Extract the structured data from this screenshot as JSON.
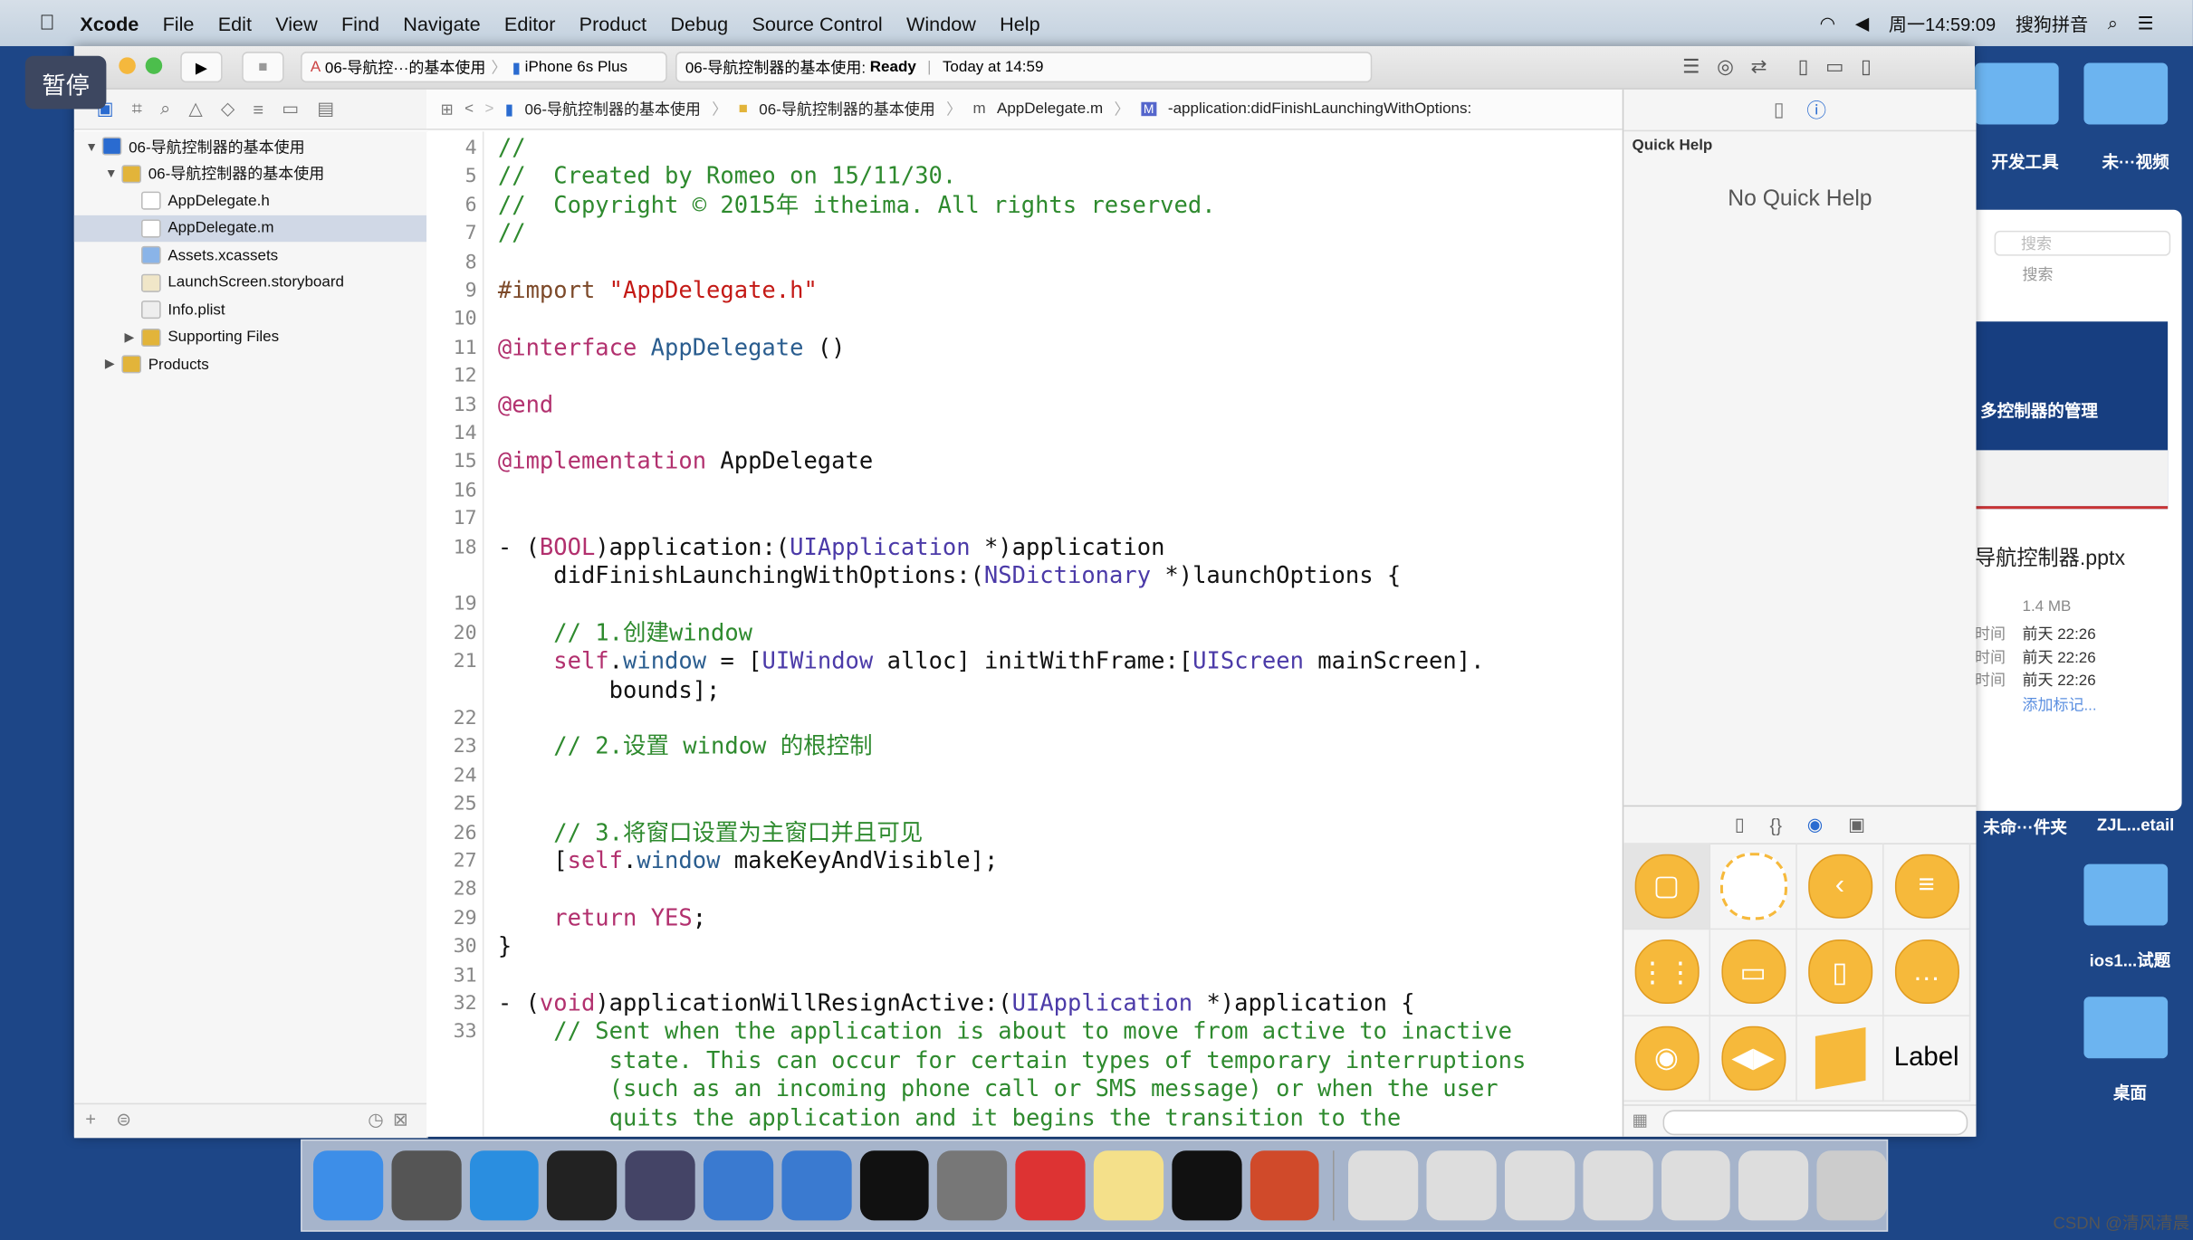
{
  "menubar": {
    "app": "Xcode",
    "items": [
      "File",
      "Edit",
      "View",
      "Find",
      "Navigate",
      "Editor",
      "Product",
      "Debug",
      "Source Control",
      "Window",
      "Help"
    ],
    "clock": "周一14:59:09",
    "input_method": "搜狗拼音"
  },
  "overlay": {
    "pause": "暂停"
  },
  "toolbar": {
    "scheme": "06-导航控···的基本使用",
    "device": "iPhone 6s Plus",
    "status_project": "06-导航控制器的基本使用:",
    "status": "Ready",
    "status_time": "Today at 14:59"
  },
  "navigator": {
    "items": [
      {
        "label": "06-导航控制器的基本使用",
        "indent": 0,
        "icon": "project",
        "open": true
      },
      {
        "label": "06-导航控制器的基本使用",
        "indent": 1,
        "icon": "folder",
        "open": true
      },
      {
        "label": "AppDelegate.h",
        "indent": 2,
        "icon": "h-file"
      },
      {
        "label": "AppDelegate.m",
        "indent": 2,
        "icon": "m-file",
        "selected": true
      },
      {
        "label": "Assets.xcassets",
        "indent": 2,
        "icon": "assets"
      },
      {
        "label": "LaunchScreen.storyboard",
        "indent": 2,
        "icon": "storyboard"
      },
      {
        "label": "Info.plist",
        "indent": 2,
        "icon": "plist"
      },
      {
        "label": "Supporting Files",
        "indent": 2,
        "icon": "folder",
        "open": false
      },
      {
        "label": "Products",
        "indent": 1,
        "icon": "folder",
        "open": false
      }
    ]
  },
  "jumpbar": [
    "06-导航控制器的基本使用",
    "06-导航控制器的基本使用",
    "AppDelegate.m",
    "-application:didFinishLaunchingWithOptions:"
  ],
  "code": [
    {
      "n": "4",
      "s": [
        [
          "//",
          "c"
        ]
      ]
    },
    {
      "n": "5",
      "s": [
        [
          "//  Created by Romeo on 15/11/30.",
          "c"
        ]
      ]
    },
    {
      "n": "6",
      "s": [
        [
          "//  Copyright © 2015年 itheima. All rights reserved.",
          "c"
        ]
      ]
    },
    {
      "n": "7",
      "s": [
        [
          "//",
          "c"
        ]
      ]
    },
    {
      "n": "8",
      "s": []
    },
    {
      "n": "9",
      "s": [
        [
          "#import ",
          "pp"
        ],
        [
          "\"AppDelegate.h\"",
          "s"
        ]
      ]
    },
    {
      "n": "10",
      "s": []
    },
    {
      "n": "11",
      "s": [
        [
          "@interface",
          "k"
        ],
        [
          " AppDelegate",
          "m"
        ],
        [
          " ()",
          ""
        ]
      ]
    },
    {
      "n": "12",
      "s": []
    },
    {
      "n": "13",
      "s": [
        [
          "@end",
          "k"
        ]
      ]
    },
    {
      "n": "14",
      "s": []
    },
    {
      "n": "15",
      "s": [
        [
          "@implementation",
          "k"
        ],
        [
          " AppDelegate",
          ""
        ]
      ]
    },
    {
      "n": "16",
      "s": []
    },
    {
      "n": "17",
      "s": []
    },
    {
      "n": "18",
      "s": [
        [
          "- (",
          ""
        ],
        [
          "BOOL",
          "k"
        ],
        [
          ")application:(",
          ""
        ],
        [
          "UIApplication",
          "t"
        ],
        [
          " *)application",
          ""
        ]
      ]
    },
    {
      "n": "",
      "s": [
        [
          "    didFinishLaunchingWithOptions:(",
          ""
        ],
        [
          "NSDictionary",
          "t"
        ],
        [
          " *)launchOptions {",
          ""
        ]
      ]
    },
    {
      "n": "19",
      "s": []
    },
    {
      "n": "20",
      "s": [
        [
          "    // 1.创建window",
          "c"
        ]
      ]
    },
    {
      "n": "21",
      "s": [
        [
          "    ",
          ""
        ],
        [
          "self",
          "k"
        ],
        [
          ".",
          ""
        ],
        [
          "window",
          "m"
        ],
        [
          " = [",
          ""
        ],
        [
          "UIWindow",
          "t"
        ],
        [
          " alloc] initWithFrame:[",
          ""
        ],
        [
          "UIScreen",
          "t"
        ],
        [
          " mainScreen].",
          ""
        ]
      ]
    },
    {
      "n": "",
      "s": [
        [
          "        bounds];",
          ""
        ]
      ]
    },
    {
      "n": "22",
      "s": []
    },
    {
      "n": "23",
      "s": [
        [
          "    // 2.设置 window 的根控制",
          "c"
        ]
      ]
    },
    {
      "n": "24",
      "s": []
    },
    {
      "n": "25",
      "s": []
    },
    {
      "n": "26",
      "s": [
        [
          "    // 3.将窗口设置为主窗口并且可见",
          "c"
        ]
      ]
    },
    {
      "n": "27",
      "s": [
        [
          "    [",
          ""
        ],
        [
          "self",
          "k"
        ],
        [
          ".",
          ""
        ],
        [
          "window",
          "m"
        ],
        [
          " makeKeyAndVisible];",
          ""
        ]
      ]
    },
    {
      "n": "28",
      "s": []
    },
    {
      "n": "29",
      "s": [
        [
          "    ",
          ""
        ],
        [
          "return",
          "k"
        ],
        [
          " ",
          ""
        ],
        [
          "YES",
          "k"
        ],
        [
          ";",
          ""
        ]
      ]
    },
    {
      "n": "30",
      "s": [
        [
          "}",
          ""
        ]
      ]
    },
    {
      "n": "31",
      "s": []
    },
    {
      "n": "32",
      "s": [
        [
          "- (",
          ""
        ],
        [
          "void",
          "k"
        ],
        [
          ")applicationWillResignActive:(",
          ""
        ],
        [
          "UIApplication",
          "t"
        ],
        [
          " *)application {",
          ""
        ]
      ]
    },
    {
      "n": "33",
      "s": [
        [
          "    // Sent when the application is about to move from active to inactive",
          "c"
        ]
      ]
    },
    {
      "n": "",
      "s": [
        [
          "        state. This can occur for certain types of temporary interruptions",
          "c"
        ]
      ]
    },
    {
      "n": "",
      "s": [
        [
          "        (such as an incoming phone call or SMS message) or when the user",
          "c"
        ]
      ]
    },
    {
      "n": "",
      "s": [
        [
          "        quits the application and it begins the transition to the",
          "c"
        ]
      ]
    }
  ],
  "inspector": {
    "title": "Quick Help",
    "empty": "No Quick Help",
    "library_label": "Label"
  },
  "desktop": {
    "folders": [
      "开发工具",
      "未···视频",
      "未命···件夹",
      "ZJL...etail",
      "ios1...试题",
      "桌面"
    ],
    "preview": {
      "search_placeholder": "搜索",
      "search_label": "搜索",
      "slide_title": "多控制器的管理",
      "file_name": "导航控制器.pptx",
      "size": "1.4 MB",
      "times": [
        "前天 22:26",
        "前天 22:26",
        "前天 22:26"
      ],
      "time_labels": [
        "时间",
        "时间",
        "时间"
      ],
      "add_tag": "添加标记..."
    }
  },
  "watermark": "CSDN @清风清晨",
  "colors": {
    "desktop": "#1d4687",
    "comment": "#2e8a2e",
    "keyword": "#b2306e",
    "type": "#4b3aa8",
    "selection": "#d0d8e6"
  }
}
